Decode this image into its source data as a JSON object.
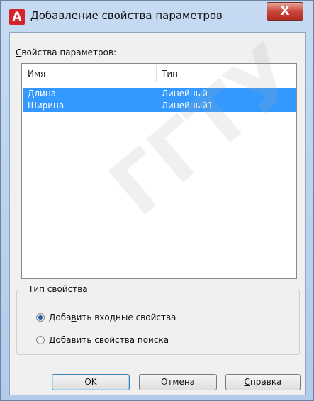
{
  "dialog": {
    "title": "Добавление свойства параметров",
    "close_glyph": "X",
    "app_icon_letter": "A"
  },
  "param_list": {
    "label_accel": "С",
    "label_rest": "войства параметров:",
    "columns": [
      "Имя",
      "Тип"
    ],
    "rows": [
      {
        "name": "Длина",
        "type": "Линейный",
        "selected": true
      },
      {
        "name": "Ширина",
        "type": "Линейный1",
        "selected": true
      }
    ]
  },
  "property_type": {
    "legend": "Тип свойства",
    "options": [
      {
        "pre": "Доба",
        "accel": "в",
        "post": "ить входные свойства",
        "checked": true
      },
      {
        "pre": "До",
        "accel": "б",
        "post": "авить свойства поиска",
        "checked": false
      }
    ]
  },
  "buttons": {
    "ok": "OK",
    "cancel": "Отмена",
    "help_accel": "С",
    "help_rest": "правка"
  },
  "watermark": "ГГТУ",
  "colors": {
    "selection": "#3399ff",
    "title_gradient_top": "#c6dbf2",
    "close_button": "#c8453a",
    "app_icon": "#d5232c"
  }
}
